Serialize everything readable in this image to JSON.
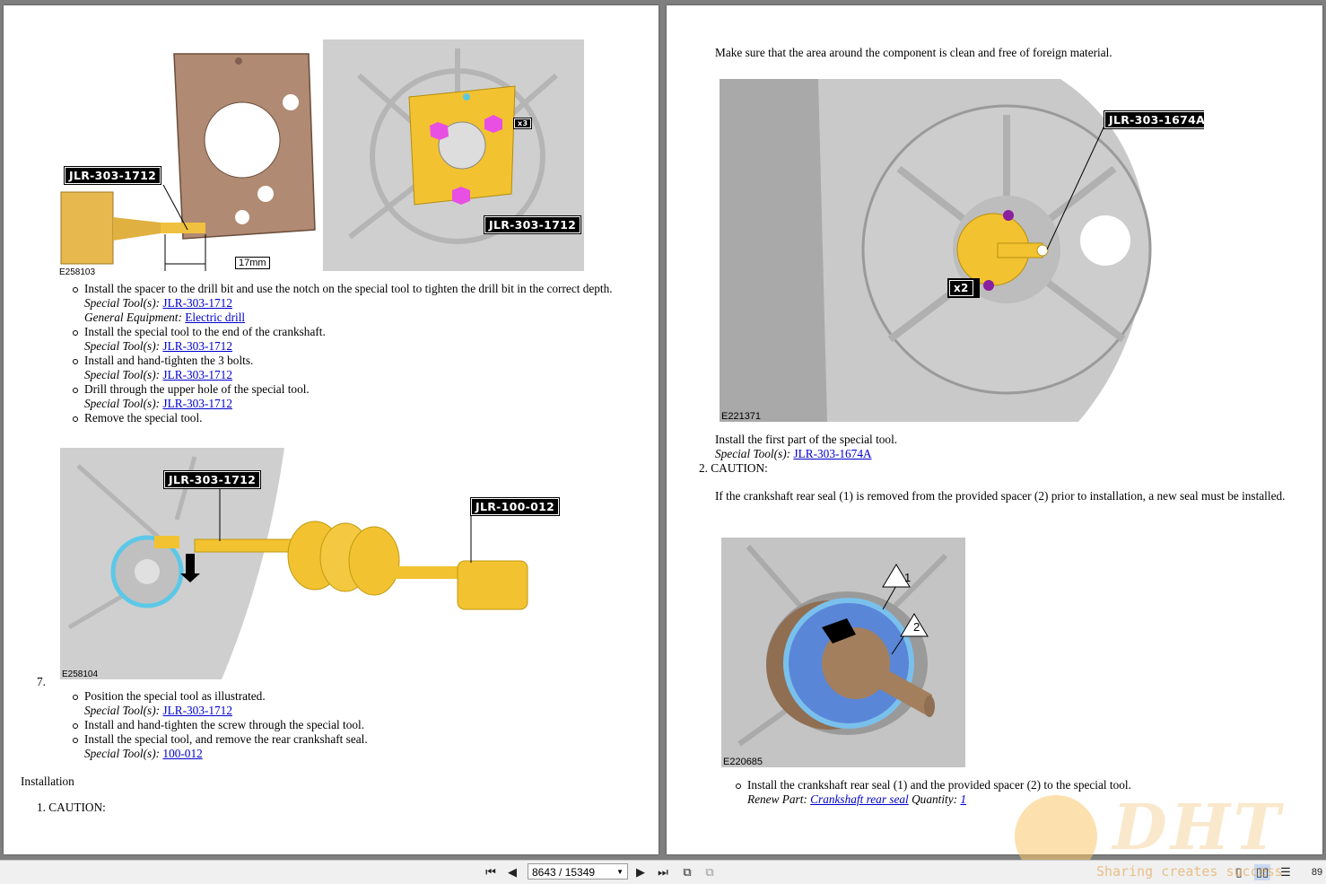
{
  "left_page": {
    "figure1": {
      "id": "E258103",
      "callout_main": "JLR-303-1712",
      "callout_right": "JLR-303-1712",
      "dimension": "17mm",
      "count": "x3"
    },
    "steps1": [
      {
        "text": "Install the spacer to the drill bit and use the notch on the special tool to tighten the drill bit in the correct depth.",
        "meta": [
          {
            "label": "Special Tool(s):",
            "link": "JLR-303-1712"
          },
          {
            "label": "General Equipment:",
            "link": "Electric drill"
          }
        ]
      },
      {
        "text": "Install the special tool to the end of the crankshaft.",
        "meta": [
          {
            "label": "Special Tool(s):",
            "link": "JLR-303-1712"
          }
        ]
      },
      {
        "text": "Install and hand-tighten the 3 bolts.",
        "meta": [
          {
            "label": "Special Tool(s):",
            "link": "JLR-303-1712"
          }
        ]
      },
      {
        "text": "Drill through the upper hole of the special tool.",
        "meta": [
          {
            "label": "Special Tool(s):",
            "link": "JLR-303-1712"
          }
        ]
      },
      {
        "text": "Remove the special tool.",
        "meta": []
      }
    ],
    "figure2": {
      "id": "E258104",
      "callout_a": "JLR-303-1712",
      "callout_b": "JLR-100-012"
    },
    "step7_number": "7.",
    "steps2": [
      {
        "text": "Position the special tool as illustrated.",
        "meta": [
          {
            "label": "Special Tool(s):",
            "link": "JLR-303-1712"
          }
        ]
      },
      {
        "text": "Install and hand-tighten the screw through the special tool.",
        "meta": []
      },
      {
        "text": "Install the special tool, and remove the rear crankshaft seal.",
        "meta": [
          {
            "label": "Special Tool(s):",
            "link": "100-012"
          }
        ]
      }
    ],
    "installation_heading": "Installation",
    "caution1": "1.  CAUTION:"
  },
  "right_page": {
    "intro": "Make sure that the area around the component is clean and free of foreign material.",
    "figure3": {
      "id": "E221371",
      "callout": "JLR-303-1674A",
      "count": "x2"
    },
    "install_first": "Install the first part of the special tool.",
    "install_first_meta": {
      "label": "Special Tool(s):",
      "link": "JLR-303-1674A"
    },
    "caution2": "2.  CAUTION:",
    "caution2_text": "If the crankshaft rear seal (1) is removed from the provided spacer (2) prior to installation, a new seal must be installed.",
    "figure4": {
      "id": "E220685",
      "label1": "1",
      "label2": "2"
    },
    "step_final": "Install the crankshaft rear seal (1) and the provided spacer (2) to the special tool.",
    "step_final_meta": {
      "label1": "Renew Part:",
      "link1": "Crankshaft rear seal",
      "label2": "Quantity:",
      "link2": "1"
    }
  },
  "toolbar": {
    "page_indicator": "8643 / 15349",
    "first_icon": "first-page-icon",
    "prev_icon": "prev-page-icon",
    "next_icon": "next-page-icon",
    "last_icon": "last-page-icon",
    "zoom_partial": "89"
  },
  "watermark": {
    "logo": "DHT",
    "slogan": "Sharing creates success"
  }
}
